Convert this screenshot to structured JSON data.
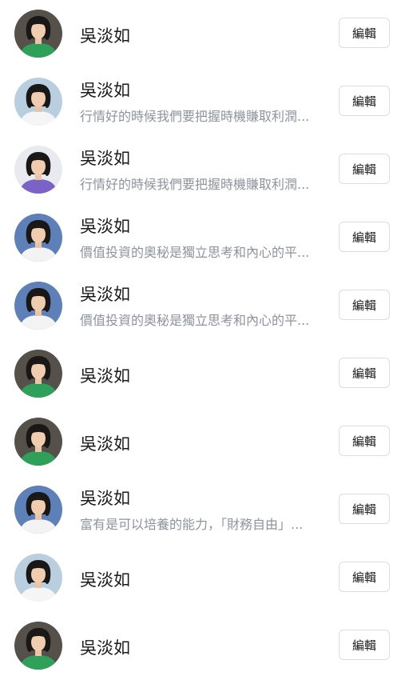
{
  "edit_label": "編輯",
  "rows": [
    {
      "name": "吳淡如",
      "subtitle": "",
      "avatar": "green"
    },
    {
      "name": "吳淡如",
      "subtitle": "行情好的時候我們要把握時機賺取利潤...",
      "avatar": "white"
    },
    {
      "name": "吳淡如",
      "subtitle": "行情好的時候我們要把握時機賺取利潤...",
      "avatar": "purple"
    },
    {
      "name": "吳淡如",
      "subtitle": "價值投資的奧秘是獨立思考和內心的平...",
      "avatar": "blue"
    },
    {
      "name": "吳淡如",
      "subtitle": "價值投資的奧秘是獨立思考和內心的平...",
      "avatar": "blue"
    },
    {
      "name": "吳淡如",
      "subtitle": "",
      "avatar": "green"
    },
    {
      "name": "吳淡如",
      "subtitle": "",
      "avatar": "green"
    },
    {
      "name": "吳淡如",
      "subtitle": "富有是可以培養的能力，「財務自由」...",
      "avatar": "blue"
    },
    {
      "name": "吳淡如",
      "subtitle": "",
      "avatar": "white"
    },
    {
      "name": "吳淡如",
      "subtitle": "",
      "avatar": "green"
    }
  ],
  "avatar_colors": {
    "green": {
      "bg": "#555049",
      "shirt": "#2fa05a",
      "hair": "#1a1717"
    },
    "white": {
      "bg": "#b9cfe0",
      "shirt": "#f5f5f5",
      "hair": "#1a1717"
    },
    "purple": {
      "bg": "#e9eaef",
      "shirt": "#7b62c6",
      "hair": "#1a1717"
    },
    "blue": {
      "bg": "#5e80b9",
      "shirt": "#f3f3f3",
      "hair": "#1a1717"
    }
  }
}
